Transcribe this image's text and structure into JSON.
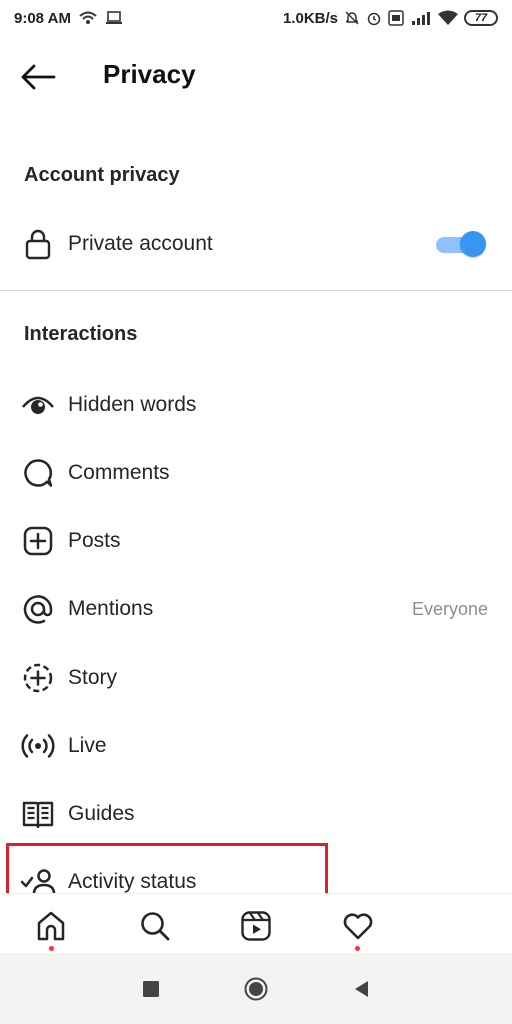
{
  "status_bar": {
    "time": "9:08 AM",
    "speed": "1.0KB/s",
    "battery": "77"
  },
  "header": {
    "title": "Privacy"
  },
  "account_privacy": {
    "heading": "Account privacy",
    "private_account": {
      "label": "Private account",
      "enabled": true
    }
  },
  "interactions": {
    "heading": "Interactions",
    "items": [
      {
        "label": "Hidden words",
        "icon": "hidden-words-icon"
      },
      {
        "label": "Comments",
        "icon": "comment-icon"
      },
      {
        "label": "Posts",
        "icon": "plus-square-icon"
      },
      {
        "label": "Mentions",
        "icon": "at-icon",
        "value": "Everyone"
      },
      {
        "label": "Story",
        "icon": "story-add-icon"
      },
      {
        "label": "Live",
        "icon": "live-icon"
      },
      {
        "label": "Guides",
        "icon": "guides-icon"
      },
      {
        "label": "Activity status",
        "icon": "activity-status-icon"
      }
    ]
  },
  "bottom_nav": [
    "home-icon",
    "search-icon",
    "reels-icon",
    "heart-icon"
  ],
  "colors": {
    "accent": "#3797f0",
    "highlight": "#d9222a",
    "notification": "#ff3040"
  }
}
